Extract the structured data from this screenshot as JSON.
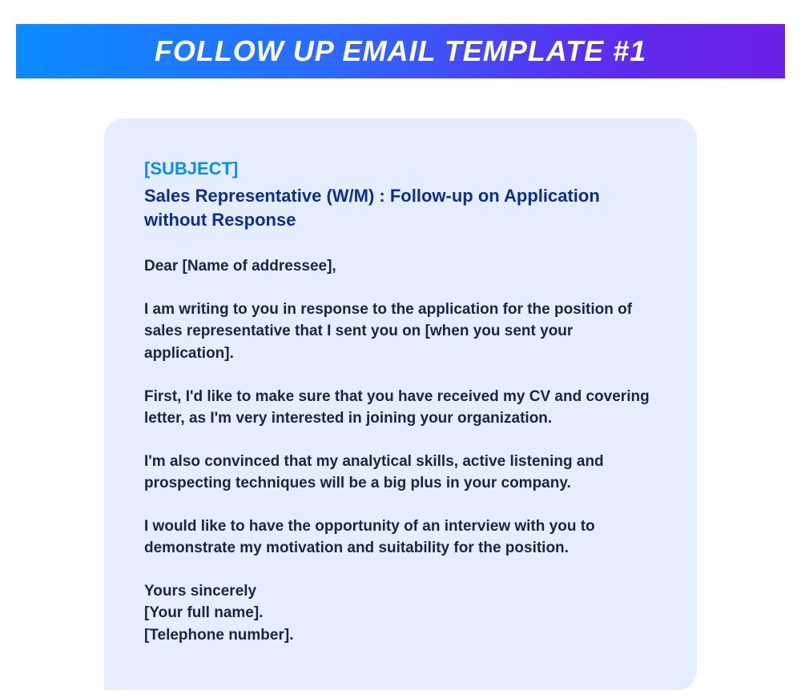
{
  "header": {
    "title": "FOLLOW UP EMAIL TEMPLATE #1"
  },
  "email": {
    "subject_label": "[SUBJECT]",
    "subject": "Sales Representative (W/M) : Follow-up on Application without Response",
    "greeting": "Dear [Name of addressee],",
    "paragraph1": "I am writing to you in response to the application for the position of sales representative that I sent you on [when you sent your application].",
    "paragraph2": "First, I'd like to make sure that you have received my CV and covering letter, as I'm very interested in joining your organization.",
    "paragraph3": "I'm also convinced that my analytical skills, active listening and prospecting techniques will be a big plus in your company.",
    "paragraph4": "I would like to have the opportunity of an interview with you to demonstrate my motivation and suitability for the position.",
    "closing1": "Yours sincerely",
    "closing2": "[Your full name].",
    "closing3": "[Telephone number]."
  }
}
